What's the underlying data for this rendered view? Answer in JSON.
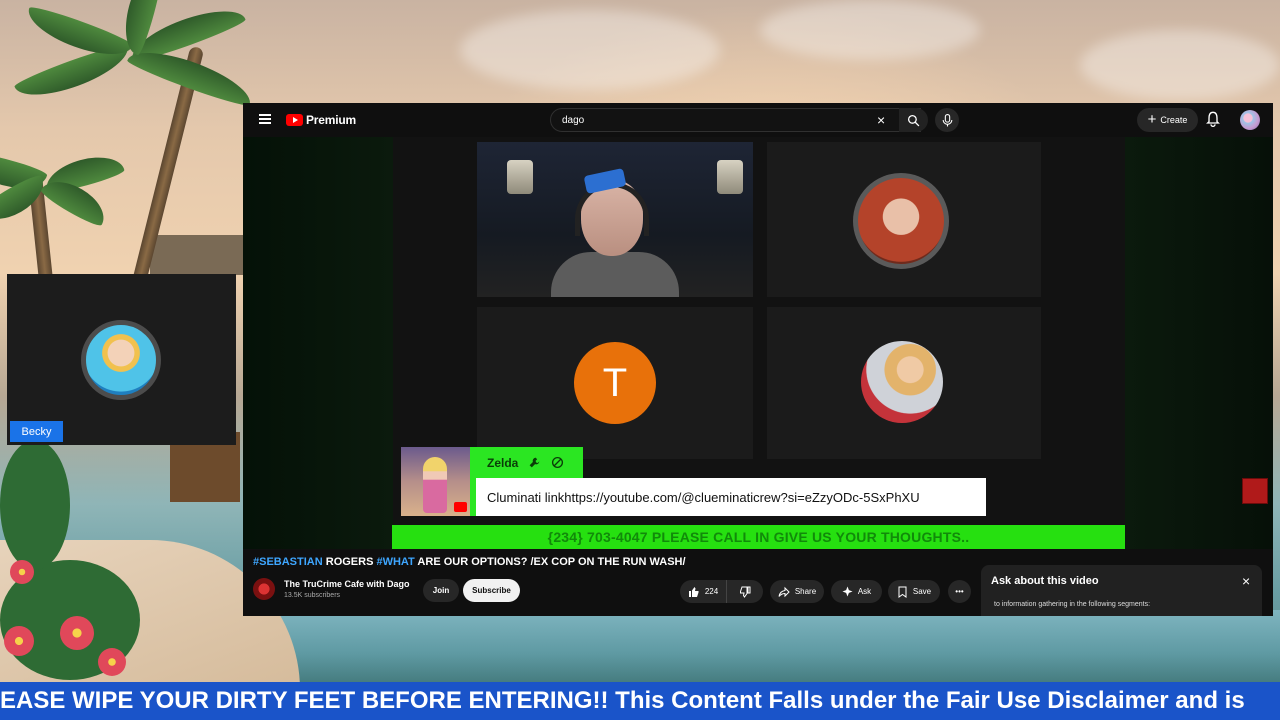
{
  "youtube": {
    "logo_text": "Premium",
    "search": {
      "value": "dago",
      "clear_glyph": "×"
    },
    "create_label": "Create",
    "icons": [
      "menu-icon",
      "search-icon",
      "mic-icon",
      "bell-icon",
      "close-icon",
      "thumbs-up-icon",
      "thumbs-down-icon",
      "share-icon",
      "sparkle-icon",
      "bookmark-icon",
      "more-icon"
    ]
  },
  "video": {
    "participant_initial": "T",
    "chat_overlay": {
      "name": "Zelda",
      "message": "Cluminati linkhttps://youtube.com/@clueminaticrew?si=eZzyODc-5SxPhXU"
    },
    "call_bar": "{234} 703-4047 PLEASE CALL IN GIVE US YOUR THOUGHTS.."
  },
  "watch": {
    "title_parts": {
      "hashtag1": "#SEBASTIAN",
      "text1": " ROGERS ",
      "hashtag2": "#WHAT",
      "text2": " ARE OUR OPTIONS? /EX COP ON THE RUN WASH/"
    },
    "channel_name": "The TruCrime Cafe with Dago",
    "subscribers": "13.5K subscribers",
    "join_label": "Join",
    "subscribe_label": "Subscribe",
    "like_count": "224",
    "share_label": "Share",
    "ask_label": "Ask",
    "save_label": "Save",
    "more_glyph": "•••"
  },
  "ask_panel": {
    "title": "Ask about this video",
    "close_glyph": "×",
    "text": "to information gathering in the following segments:"
  },
  "becky_tile": {
    "label": "Becky"
  },
  "ticker": {
    "text": "EASE WIPE YOUR DIRTY FEET BEFORE ENTERING!! This Content Falls under the Fair Use Disclaimer and is"
  },
  "colors": {
    "youtube_red": "#ff0000",
    "chat_green": "#2be622",
    "call_bar_green": "#26e010",
    "ticker_blue": "#1a54c9",
    "participant_orange": "#e8710a",
    "name_tag_blue": "#1a73e8",
    "hashtag_blue": "#3ea6ff"
  }
}
